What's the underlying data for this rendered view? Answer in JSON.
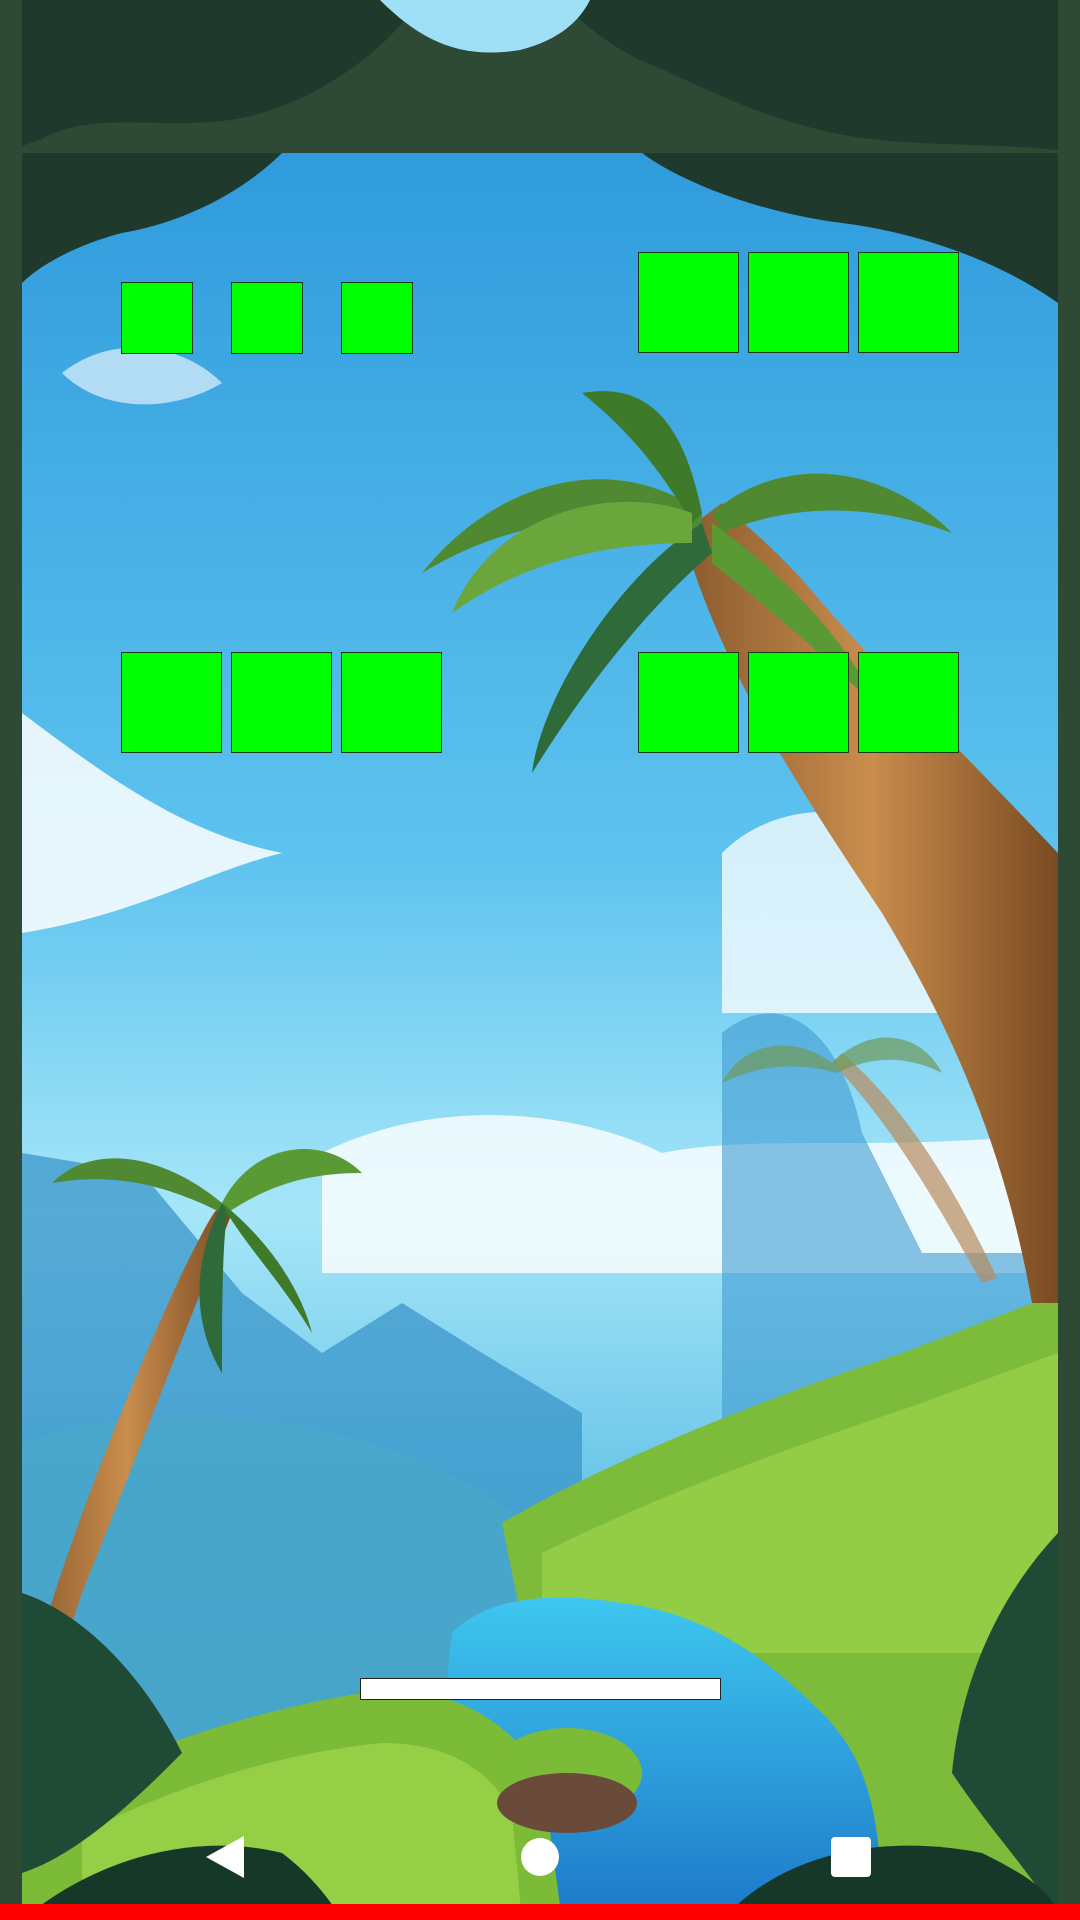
{
  "scene": {
    "colors": {
      "frame": "#2e4a34",
      "tile": "#00ff00",
      "progress_track": "#ffffff",
      "bottom_strip": "#ff0000"
    }
  },
  "tiles": {
    "row1_left_count": 3,
    "row1_right_count": 3,
    "row2_left_count": 3,
    "row2_right_count": 3
  },
  "loading": {
    "progress": 0
  },
  "navbar": {
    "back_icon": "back-triangle-icon",
    "home_icon": "home-circle-icon",
    "recents_icon": "recents-square-icon"
  }
}
